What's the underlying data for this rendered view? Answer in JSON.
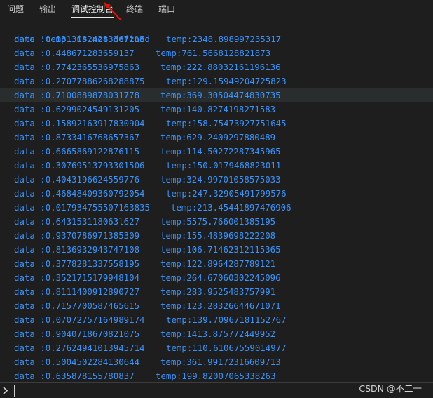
{
  "tabs": [
    {
      "label": "问题"
    },
    {
      "label": "输出"
    },
    {
      "label": "调试控制台"
    },
    {
      "label": "终端"
    },
    {
      "label": "端口"
    }
  ],
  "console": {
    "error_text": "name 'temp' is not defined",
    "lines": [
      {
        "data": "data :0.13130824283367215",
        "temp": "temp:2348.898997235317"
      },
      {
        "data": "data :0.448671283659137",
        "temp": "temp:761.5668128821873"
      },
      {
        "data": "data :0.7742365536975863",
        "temp": "temp:222.88032161196136"
      },
      {
        "data": "data :0.27077886268288875",
        "temp": "temp:129.15949204725823"
      },
      {
        "data": "data :0.7100889878031778",
        "temp": "temp:369.30504474830735"
      },
      {
        "data": "data :0.6299024549131205",
        "temp": "temp:140.8274198271583"
      },
      {
        "data": "data :0.15892163917830904",
        "temp": "temp:158.75473927751645"
      },
      {
        "data": "data :0.8733416768657367",
        "temp": "temp:629.2409297880489"
      },
      {
        "data": "data :0.6665869122876115",
        "temp": "temp:114.50272287345965"
      },
      {
        "data": "data :0.30769513793301506",
        "temp": "temp:150.0179468823011"
      },
      {
        "data": "data :0.4043196624559776",
        "temp": "temp:324.99701058575033"
      },
      {
        "data": "data :0.46848409360792054",
        "temp": "temp:247.32905491799576"
      },
      {
        "data": "data :0.017934755507163835",
        "temp": "temp:213.45441897476906"
      },
      {
        "data": "data :0.643153118063l627",
        "temp": "temp:5575.766001385195"
      },
      {
        "data": "data :0.9370786971385309",
        "temp": "temp:155.4839698222208"
      },
      {
        "data": "data :0.8136932943747108",
        "temp": "temp:106.71462312115365"
      },
      {
        "data": "data :0.3778281337558195",
        "temp": "temp:122.8964287789121"
      },
      {
        "data": "data :0.3521715179948104",
        "temp": "temp:264.67060302245096"
      },
      {
        "data": "data :0.8111400912890727",
        "temp": "temp:283.9525483757991"
      },
      {
        "data": "data :0.7157700587465615",
        "temp": "temp:123.28326644671071"
      },
      {
        "data": "data :0.07072757164989174",
        "temp": "temp:139.70967181152767"
      },
      {
        "data": "data :0.9040718670821075",
        "temp": "temp:1413.875772449952"
      },
      {
        "data": "data :0.27624941013945714",
        "temp": "temp:110.61067559014977"
      },
      {
        "data": "data :0.5004502284130644",
        "temp": "temp:361.99172316609713"
      },
      {
        "data": "data :0.635878155780837",
        "temp": "temp:199.82007065338263"
      }
    ]
  },
  "watermark": "CSDN @不二一",
  "colors": {
    "background": "#1e1e1e",
    "text": "#3794ff",
    "arrow": "#e51400"
  },
  "icons": {
    "prompt": "chevron-right-icon",
    "annotation": "red-arrow"
  }
}
